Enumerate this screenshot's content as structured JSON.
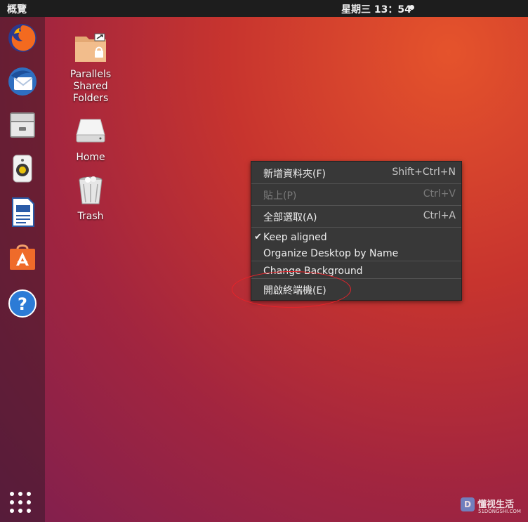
{
  "topbar": {
    "activities": "概覽",
    "clock": "星期三 13：54"
  },
  "dock": {
    "items": [
      {
        "name": "firefox-icon"
      },
      {
        "name": "thunderbird-icon"
      },
      {
        "name": "files-icon"
      },
      {
        "name": "rhythmbox-icon"
      },
      {
        "name": "libreoffice-writer-icon"
      },
      {
        "name": "software-center-icon"
      },
      {
        "name": "help-icon"
      }
    ],
    "show_apps_icon": "grid-icon"
  },
  "desktop": {
    "icons": [
      {
        "label": "Parallels\nShared\nFolders",
        "icon": "folder-shared-icon"
      },
      {
        "label": "Home",
        "icon": "drive-icon"
      },
      {
        "label": "Trash",
        "icon": "trash-icon"
      }
    ]
  },
  "context_menu": {
    "new_folder": {
      "label": "新增資料夾(F)",
      "accel": "Shift+Ctrl+N"
    },
    "paste": {
      "label": "貼上(P)",
      "accel": "Ctrl+V",
      "disabled": true
    },
    "select_all": {
      "label": "全部選取(A)",
      "accel": "Ctrl+A"
    },
    "keep_aligned": {
      "label": "Keep aligned",
      "checked": true,
      "check_glyph": "✔"
    },
    "organize": {
      "label": "Organize Desktop by Name"
    },
    "change_background": {
      "label": "Change Background"
    },
    "open_terminal": {
      "label": "開啟終端機(E)"
    }
  },
  "watermark": {
    "text": "懂视生活",
    "logo": "D",
    "sub": "51DONGSHI.COM"
  },
  "colors": {
    "accent_ring": "#e8232a",
    "menu_bg": "#383838",
    "topbar_bg": "#1d1d1d"
  }
}
